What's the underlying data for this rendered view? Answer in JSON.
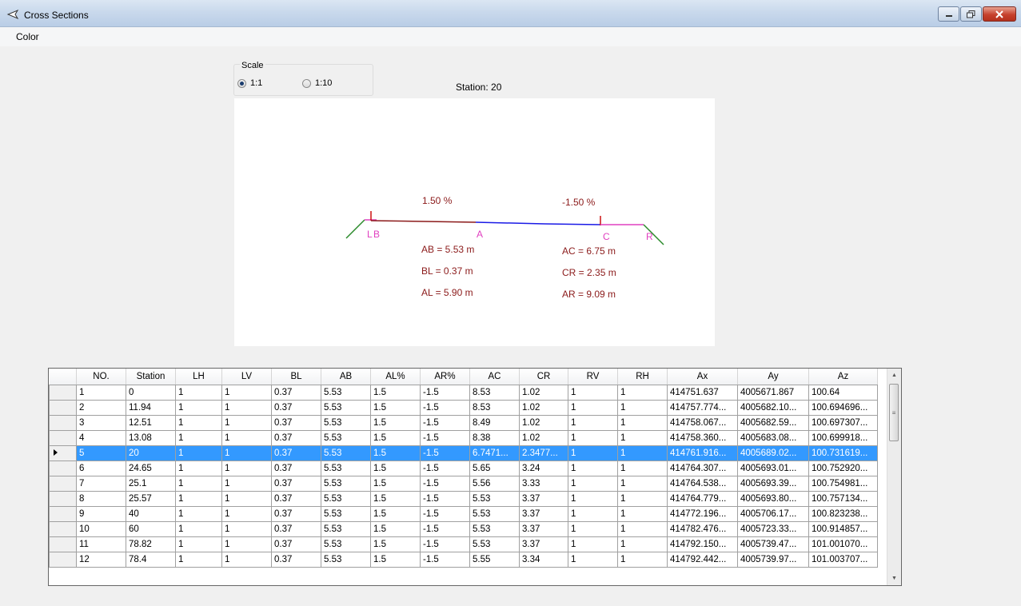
{
  "window": {
    "title": "Cross Sections"
  },
  "menu": {
    "items": [
      "Color"
    ]
  },
  "scale": {
    "label": "Scale",
    "options": [
      {
        "label": "1:1",
        "checked": true
      },
      {
        "label": "1:10",
        "checked": false
      }
    ]
  },
  "station_label": "Station: 20",
  "section": {
    "slope_left": "1.50 %",
    "slope_right": "-1.50 %",
    "points": {
      "L": "L",
      "B": "B",
      "A": "A",
      "C": "C",
      "R": "R"
    },
    "dims_left": [
      "AB = 5.53 m",
      "BL = 0.37 m",
      "AL = 5.90 m"
    ],
    "dims_right": [
      "AC = 6.75 m",
      "CR = 2.35 m",
      "AR = 9.09 m"
    ],
    "colors": {
      "text": "#8b1a1a",
      "label": "#e040c0",
      "left_road": "#8b1a1a",
      "right_road": "#1a1ae6",
      "slope": "#2a8a2a"
    }
  },
  "grid": {
    "columns": [
      "NO.",
      "Station",
      "LH",
      "LV",
      "BL",
      "AB",
      "AL%",
      "AR%",
      "AC",
      "CR",
      "RV",
      "RH",
      "Ax",
      "Ay",
      "Az"
    ],
    "selected_row": 4,
    "rows": [
      [
        "1",
        "0",
        "1",
        "1",
        "0.37",
        "5.53",
        "1.5",
        "-1.5",
        "8.53",
        "1.02",
        "1",
        "1",
        "414751.637",
        "4005671.867",
        "100.64"
      ],
      [
        "2",
        "11.94",
        "1",
        "1",
        "0.37",
        "5.53",
        "1.5",
        "-1.5",
        "8.53",
        "1.02",
        "1",
        "1",
        "414757.774...",
        "4005682.10...",
        "100.694696..."
      ],
      [
        "3",
        "12.51",
        "1",
        "1",
        "0.37",
        "5.53",
        "1.5",
        "-1.5",
        "8.49",
        "1.02",
        "1",
        "1",
        "414758.067...",
        "4005682.59...",
        "100.697307..."
      ],
      [
        "4",
        "13.08",
        "1",
        "1",
        "0.37",
        "5.53",
        "1.5",
        "-1.5",
        "8.38",
        "1.02",
        "1",
        "1",
        "414758.360...",
        "4005683.08...",
        "100.699918..."
      ],
      [
        "5",
        "20",
        "1",
        "1",
        "0.37",
        "5.53",
        "1.5",
        "-1.5",
        "6.7471...",
        "2.3477...",
        "1",
        "1",
        "414761.916...",
        "4005689.02...",
        "100.731619..."
      ],
      [
        "6",
        "24.65",
        "1",
        "1",
        "0.37",
        "5.53",
        "1.5",
        "-1.5",
        "5.65",
        "3.24",
        "1",
        "1",
        "414764.307...",
        "4005693.01...",
        "100.752920..."
      ],
      [
        "7",
        "25.1",
        "1",
        "1",
        "0.37",
        "5.53",
        "1.5",
        "-1.5",
        "5.56",
        "3.33",
        "1",
        "1",
        "414764.538...",
        "4005693.39...",
        "100.754981..."
      ],
      [
        "8",
        "25.57",
        "1",
        "1",
        "0.37",
        "5.53",
        "1.5",
        "-1.5",
        "5.53",
        "3.37",
        "1",
        "1",
        "414764.779...",
        "4005693.80...",
        "100.757134..."
      ],
      [
        "9",
        "40",
        "1",
        "1",
        "0.37",
        "5.53",
        "1.5",
        "-1.5",
        "5.53",
        "3.37",
        "1",
        "1",
        "414772.196...",
        "4005706.17...",
        "100.823238..."
      ],
      [
        "10",
        "60",
        "1",
        "1",
        "0.37",
        "5.53",
        "1.5",
        "-1.5",
        "5.53",
        "3.37",
        "1",
        "1",
        "414782.476...",
        "4005723.33...",
        "100.914857..."
      ],
      [
        "11",
        "78.82",
        "1",
        "1",
        "0.37",
        "5.53",
        "1.5",
        "-1.5",
        "5.53",
        "3.37",
        "1",
        "1",
        "414792.150...",
        "4005739.47...",
        "101.001070..."
      ],
      [
        "12",
        "78.4",
        "1",
        "1",
        "0.37",
        "5.53",
        "1.5",
        "-1.5",
        "5.55",
        "3.34",
        "1",
        "1",
        "414792.442...",
        "4005739.97...",
        "101.003707..."
      ]
    ]
  }
}
